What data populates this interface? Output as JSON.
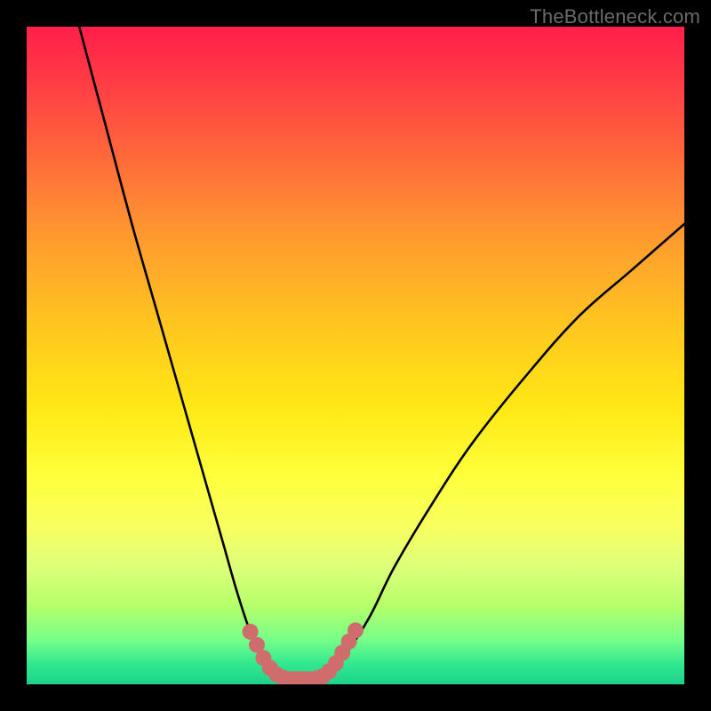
{
  "watermark": "TheBottleneck.com",
  "chart_data": {
    "type": "line",
    "title": "",
    "xlabel": "",
    "ylabel": "",
    "xlim": [
      0,
      100
    ],
    "ylim": [
      0,
      100
    ],
    "series": [
      {
        "name": "left-descending-curve",
        "x": [
          8,
          12,
          16,
          20,
          24,
          28,
          30,
          32,
          34,
          36,
          37.5
        ],
        "values": [
          100,
          85,
          70,
          56,
          42,
          28,
          21,
          14,
          8,
          4,
          1.5
        ]
      },
      {
        "name": "right-ascending-curve",
        "x": [
          45,
          48,
          52,
          56,
          62,
          68,
          76,
          84,
          92,
          100
        ],
        "values": [
          1.5,
          4,
          10,
          18,
          28,
          37,
          47,
          56,
          63,
          70
        ]
      },
      {
        "name": "valley-flat",
        "x": [
          37.5,
          45
        ],
        "values": [
          1.0,
          1.0
        ]
      }
    ],
    "markers": [
      {
        "name": "valley-dots-left",
        "color": "#cf6c6c",
        "points": [
          {
            "x": 34.0,
            "y": 8.0
          },
          {
            "x": 35.0,
            "y": 6.0
          },
          {
            "x": 36.0,
            "y": 4.0
          },
          {
            "x": 37.0,
            "y": 2.5
          },
          {
            "x": 38.0,
            "y": 1.5
          },
          {
            "x": 39.0,
            "y": 1.0
          },
          {
            "x": 40.0,
            "y": 0.8
          },
          {
            "x": 41.0,
            "y": 0.8
          },
          {
            "x": 42.0,
            "y": 0.8
          },
          {
            "x": 43.0,
            "y": 0.8
          },
          {
            "x": 44.0,
            "y": 0.9
          }
        ]
      },
      {
        "name": "valley-dots-right",
        "color": "#cf6c6c",
        "points": [
          {
            "x": 45.0,
            "y": 1.2
          },
          {
            "x": 46.0,
            "y": 2.0
          },
          {
            "x": 47.0,
            "y": 3.2
          },
          {
            "x": 48.0,
            "y": 4.8
          },
          {
            "x": 49.0,
            "y": 6.5
          },
          {
            "x": 50.0,
            "y": 8.2
          }
        ]
      }
    ],
    "background_gradient": {
      "top": "#ff1f4a",
      "mid": "#ffe815",
      "bottom": "#1dd28a"
    }
  }
}
